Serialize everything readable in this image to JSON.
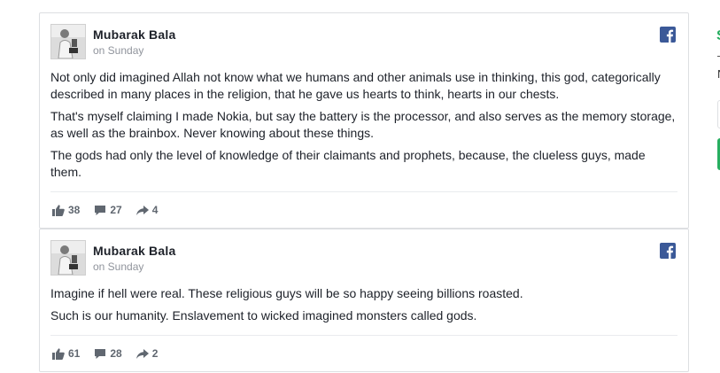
{
  "posts": [
    {
      "author": "Mubarak Bala",
      "time": "on Sunday",
      "paragraphs": [
        "Not only did imagined Allah not know what we humans and other animals use in thinking, this god, categorically described in many places in the religion, that he gave us hearts to think, hearts in our chests.",
        "That's myself claiming I made Nokia, but say the battery is the processor, and also serves as the memory storage, as well as the brainbox. Never knowing about these things.",
        "The gods had only the level of knowledge of their claimants and prophets, because, the clueless guys, made them."
      ],
      "likes": "38",
      "comments": "27",
      "shares": "4"
    },
    {
      "author": "Mubarak Bala",
      "time": "on Sunday",
      "paragraphs": [
        "Imagine if hell were real. These religious guys will be so happy seeing billions roasted.",
        "Such is our humanity. Enslavement to wicked imagined monsters called gods."
      ],
      "likes": "61",
      "comments": "28",
      "shares": "2"
    }
  ],
  "side": {
    "s_letter": "S",
    "n_letter": "N"
  },
  "colors": {
    "facebook_blue": "#3b5998",
    "accent_green": "#27ae60",
    "meta_gray": "#90949c"
  },
  "icons": {
    "platform": "facebook-icon",
    "like": "thumbs-up-icon",
    "comment": "comment-icon",
    "share": "share-icon"
  }
}
